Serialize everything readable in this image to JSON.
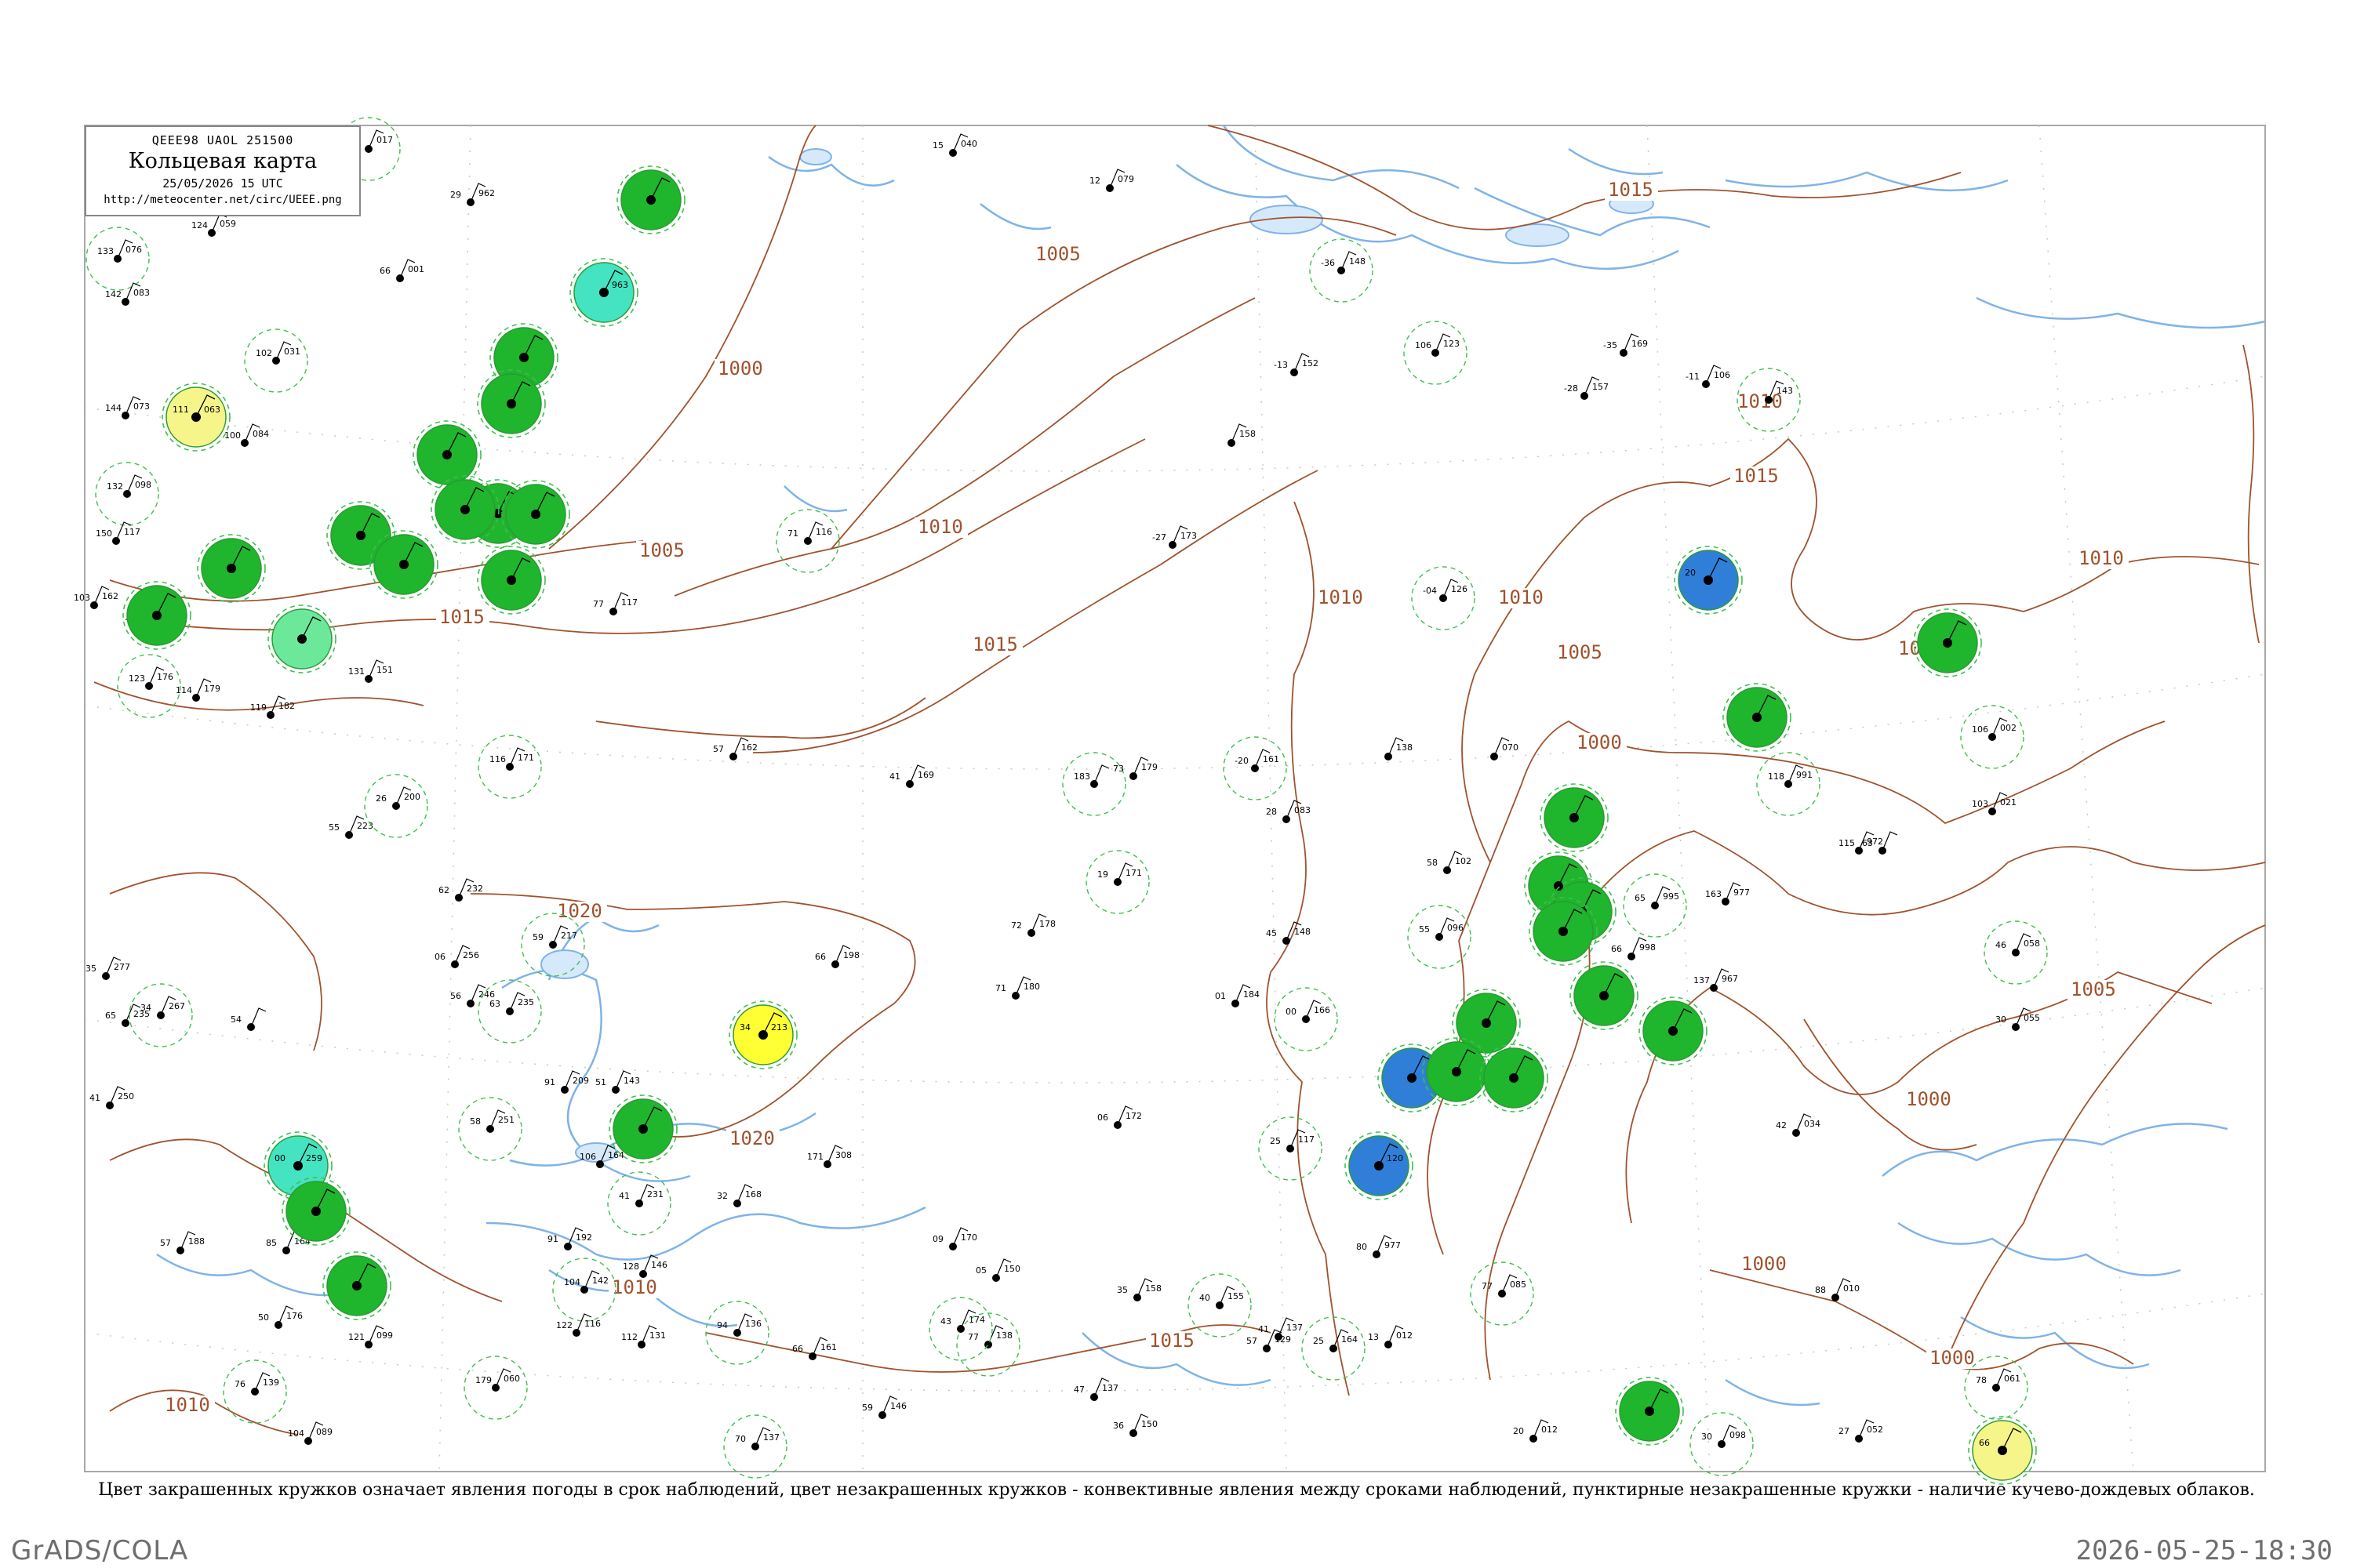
{
  "map": {
    "code_line": "QEEE98  UAOL  251500",
    "title": "Кольцевая карта",
    "datetime": "25/05/2026 15 UTC",
    "url": "http://meteocenter.net/circ/UEEE.png",
    "isobar_labels": [
      "1015",
      "1005",
      "1000",
      "1010",
      "1005",
      "1010",
      "1015",
      "1015",
      "1010",
      "1010",
      "1015",
      "1000",
      "1020",
      "1020",
      "1005",
      "1010",
      "1005",
      "1000",
      "1005",
      "1000",
      "1000",
      "1015",
      "1010",
      "1010"
    ],
    "colors": {
      "isobar": "#a0522d",
      "water": "#7fb3e8",
      "station_green": "#1fb52d",
      "station_cyan": "#44e3c1",
      "station_blue": "#2f7fd9",
      "station_yellow": "#ffff33",
      "station_pale_yellow": "#f5f58a",
      "station_light_green": "#6ce89a",
      "dashed_ring": "#3fbf4f"
    }
  },
  "stations": [
    {
      "c": "green",
      "name": "",
      "t": "",
      "p": ""
    },
    {
      "c": "cyan",
      "name": "",
      "t": "",
      "p": "963"
    },
    {
      "c": "green",
      "name": "",
      "t": "",
      "p": ""
    },
    {
      "c": "green",
      "name": "",
      "t": "",
      "p": ""
    },
    {
      "c": "green",
      "name": "",
      "t": "",
      "p": ""
    },
    {
      "c": "green",
      "name": "",
      "t": "",
      "p": ""
    },
    {
      "c": "green",
      "name": "",
      "t": "",
      "p": ""
    },
    {
      "c": "green",
      "name": "",
      "t": "",
      "p": ""
    },
    {
      "c": "green",
      "name": "",
      "t": "",
      "p": ""
    },
    {
      "c": "green",
      "name": "",
      "t": "",
      "p": ""
    },
    {
      "c": "green",
      "name": "",
      "t": "",
      "p": ""
    },
    {
      "c": "green",
      "name": "",
      "t": "",
      "p": ""
    },
    {
      "c": "green",
      "name": "",
      "t": "",
      "p": ""
    },
    {
      "c": "light-green",
      "name": "",
      "t": "",
      "p": ""
    },
    {
      "c": "pale-yellow",
      "name": "",
      "t": "111",
      "p": "063"
    },
    {
      "c": "yellow",
      "name": "",
      "t": "34",
      "p": "213"
    },
    {
      "c": "green",
      "name": "",
      "t": "",
      "p": ""
    },
    {
      "c": "cyan",
      "name": "",
      "t": "00",
      "p": "259"
    },
    {
      "c": "green",
      "name": "",
      "t": "",
      "p": ""
    },
    {
      "c": "green",
      "name": "",
      "t": "",
      "p": ""
    },
    {
      "c": "blue",
      "name": "",
      "t": "20",
      "p": ""
    },
    {
      "c": "green",
      "name": "",
      "t": "",
      "p": ""
    },
    {
      "c": "green",
      "name": "",
      "t": "",
      "p": ""
    },
    {
      "c": "green",
      "name": "",
      "t": "",
      "p": ""
    },
    {
      "c": "green",
      "name": "",
      "t": "",
      "p": ""
    },
    {
      "c": "green",
      "name": "",
      "t": "",
      "p": ""
    },
    {
      "c": "green",
      "name": "",
      "t": "",
      "p": ""
    },
    {
      "c": "green",
      "name": "",
      "t": "",
      "p": ""
    },
    {
      "c": "green",
      "name": "",
      "t": "",
      "p": ""
    },
    {
      "c": "green",
      "name": "",
      "t": "",
      "p": ""
    },
    {
      "c": "blue",
      "name": "",
      "t": "",
      "p": ""
    },
    {
      "c": "green",
      "name": "",
      "t": "",
      "p": ""
    },
    {
      "c": "green",
      "name": "",
      "t": "",
      "p": ""
    },
    {
      "c": "blue",
      "name": "",
      "t": "",
      "p": "120"
    },
    {
      "c": "green",
      "name": "",
      "t": "",
      "p": ""
    },
    {
      "c": "pale-yellow",
      "name": "",
      "t": "66",
      "p": ""
    }
  ],
  "plots": [
    {
      "t": "",
      "p": "017"
    },
    {
      "t": "29",
      "p": "962"
    },
    {
      "t": "124",
      "p": "059"
    },
    {
      "t": "133",
      "p": "076"
    },
    {
      "t": "142",
      "p": "083"
    },
    {
      "t": "66",
      "p": "001"
    },
    {
      "t": "102",
      "p": "031"
    },
    {
      "t": "144",
      "p": "073"
    },
    {
      "t": "100",
      "p": "084"
    },
    {
      "t": "132",
      "p": "098"
    },
    {
      "t": "150",
      "p": "117"
    },
    {
      "t": "103",
      "p": "162"
    },
    {
      "t": "71",
      "p": "116"
    },
    {
      "t": "77",
      "p": "117"
    },
    {
      "t": "131",
      "p": "151"
    },
    {
      "t": "123",
      "p": "176"
    },
    {
      "t": "114",
      "p": "179"
    },
    {
      "t": "119",
      "p": "182"
    },
    {
      "t": "116",
      "p": "171"
    },
    {
      "t": "57",
      "p": "162"
    },
    {
      "t": "41",
      "p": "169"
    },
    {
      "t": "183",
      "p": ""
    },
    {
      "t": "73",
      "p": "179"
    },
    {
      "t": "28",
      "p": "083"
    },
    {
      "t": "-20",
      "p": "161"
    },
    {
      "t": "",
      "p": "138"
    },
    {
      "t": "",
      "p": "070"
    },
    {
      "t": "-36",
      "p": "148"
    },
    {
      "t": "-13",
      "p": "152"
    },
    {
      "t": "",
      "p": "158"
    },
    {
      "t": "106",
      "p": "123"
    },
    {
      "t": "-28",
      "p": "157"
    },
    {
      "t": "-35",
      "p": "169"
    },
    {
      "t": "",
      "p": "143"
    },
    {
      "t": "-11",
      "p": "106"
    },
    {
      "t": "-27",
      "p": "173"
    },
    {
      "t": "-04",
      "p": "126"
    },
    {
      "t": "15",
      "p": "040"
    },
    {
      "t": "12",
      "p": "079"
    },
    {
      "t": "118",
      "p": "991"
    },
    {
      "t": "115",
      "p": "972"
    },
    {
      "t": "63",
      "p": ""
    },
    {
      "t": "106",
      "p": "002"
    },
    {
      "t": "103",
      "p": "021"
    },
    {
      "t": "163",
      "p": "977"
    },
    {
      "t": "65",
      "p": "995"
    },
    {
      "t": "66",
      "p": "998"
    },
    {
      "t": "137",
      "p": "967"
    },
    {
      "t": "46",
      "p": "058"
    },
    {
      "t": "30",
      "p": "055"
    },
    {
      "t": "58",
      "p": "102"
    },
    {
      "t": "55",
      "p": "096"
    },
    {
      "t": "72",
      "p": "178"
    },
    {
      "t": "45",
      "p": "148"
    },
    {
      "t": "19",
      "p": "171"
    },
    {
      "t": "71",
      "p": "180"
    },
    {
      "t": "66",
      "p": "198"
    },
    {
      "t": "59",
      "p": "217"
    },
    {
      "t": "06",
      "p": "256"
    },
    {
      "t": "56",
      "p": "246"
    },
    {
      "t": "63",
      "p": "235"
    },
    {
      "t": "62",
      "p": "232"
    },
    {
      "t": "55",
      "p": "223"
    },
    {
      "t": "26",
      "p": "200"
    },
    {
      "t": "35",
      "p": "277"
    },
    {
      "t": "65",
      "p": "235"
    },
    {
      "t": "34",
      "p": "267"
    },
    {
      "t": "54",
      "p": ""
    },
    {
      "t": "41",
      "p": "250"
    },
    {
      "t": "58",
      "p": "251"
    },
    {
      "t": "91",
      "p": "209"
    },
    {
      "t": "51",
      "p": "143"
    },
    {
      "t": "00",
      "p": "166"
    },
    {
      "t": "01",
      "p": "184"
    },
    {
      "t": "06",
      "p": "172"
    },
    {
      "t": "25",
      "p": "117"
    },
    {
      "t": "80",
      "p": "977"
    },
    {
      "t": "42",
      "p": "034"
    },
    {
      "t": "77",
      "p": "085"
    },
    {
      "t": "13",
      "p": "012"
    },
    {
      "t": "88",
      "p": "010"
    },
    {
      "t": "78",
      "p": "061"
    },
    {
      "t": "20",
      "p": "012"
    },
    {
      "t": "27",
      "p": "052"
    },
    {
      "t": "30",
      "p": "098"
    },
    {
      "t": "57",
      "p": "188"
    },
    {
      "t": "50",
      "p": "176"
    },
    {
      "t": "76",
      "p": "139"
    },
    {
      "t": "85",
      "p": "164"
    },
    {
      "t": "121",
      "p": "099"
    },
    {
      "t": "179",
      "p": "060"
    },
    {
      "t": "104",
      "p": "089"
    },
    {
      "t": "91",
      "p": "192"
    },
    {
      "t": "104",
      "p": "142"
    },
    {
      "t": "122",
      "p": "116"
    },
    {
      "t": "112",
      "p": "131"
    },
    {
      "t": "94",
      "p": "136"
    },
    {
      "t": "66",
      "p": "161"
    },
    {
      "t": "59",
      "p": "146"
    },
    {
      "t": "77",
      "p": "138"
    },
    {
      "t": "47",
      "p": "137"
    },
    {
      "t": "36",
      "p": "150"
    },
    {
      "t": "40",
      "p": "155"
    },
    {
      "t": "41",
      "p": "137"
    },
    {
      "t": "57",
      "p": "129"
    },
    {
      "t": "25",
      "p": "164"
    },
    {
      "t": "09",
      "p": "170"
    },
    {
      "t": "05",
      "p": "150"
    },
    {
      "t": "43",
      "p": "174"
    },
    {
      "t": "32",
      "p": "168"
    },
    {
      "t": "106",
      "p": "164"
    },
    {
      "t": "41",
      "p": "231"
    },
    {
      "t": "171",
      "p": "308"
    },
    {
      "t": "35",
      "p": "158"
    },
    {
      "t": "70",
      "p": "137"
    },
    {
      "t": "128",
      "p": "146"
    }
  ],
  "labels": {
    "caption": "Цвет закрашенных кружков означает явления погоды в срок наблюдений, цвет незакрашенных кружков - конвективные явления между сроками наблюдений, пунктирные незакрашенные кружки - наличие кучево-дождевых облаков.",
    "footer_left": "GrADS/COLA",
    "footer_right": "2026-05-25-18:30"
  }
}
